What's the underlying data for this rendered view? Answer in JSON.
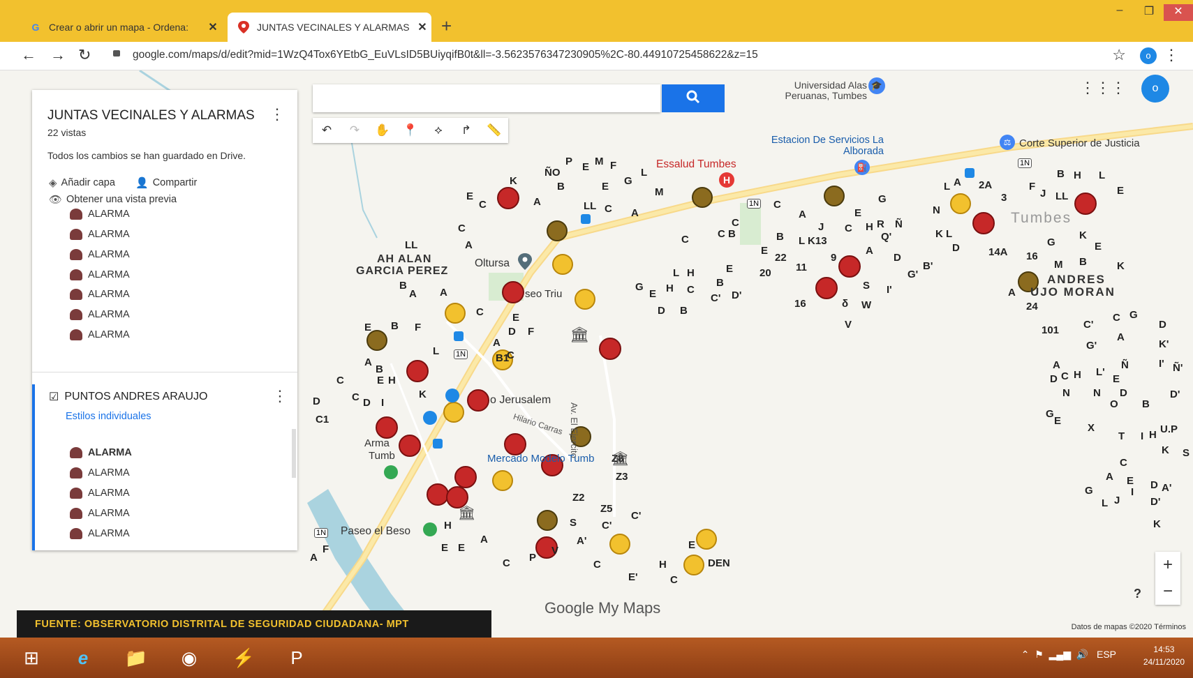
{
  "browser": {
    "tabs": [
      {
        "title": "Crear o abrir un mapa - Ordena:",
        "favicon": "google-g-icon"
      },
      {
        "title": "JUNTAS VECINALES Y ALARMAS",
        "favicon": "my-maps-icon",
        "active": true
      }
    ],
    "new_tab": "+",
    "url": "google.com/maps/d/edit?mid=1WzQ4Tox6YEtbG_EuVLsID5BUiyqifB0t&ll=-3.5623576347230905%2C-80.44910725458622&z=15",
    "profile_initial": "o"
  },
  "panel": {
    "title": "JUNTAS VECINALES Y ALARMAS",
    "views": "22 vistas",
    "saved": "Todos los cambios se han guardado en Drive.",
    "add_layer": "Añadir capa",
    "share": "Compartir",
    "preview": "Obtener una vista previa",
    "layer1_items": [
      "ALARMA",
      "ALARMA",
      "ALARMA",
      "ALARMA",
      "ALARMA",
      "ALARMA",
      "ALARMA"
    ],
    "layer2": {
      "title": "PUNTOS ANDRES ARAUJO",
      "style": "Estilos individuales",
      "items": [
        "ALARMA",
        "ALARMA",
        "ALARMA",
        "ALARMA",
        "ALARMA"
      ]
    }
  },
  "map": {
    "places": {
      "university": "Universidad Alas Peruanas, Tumbes",
      "gas": "Estacion De Servicios La Alborada",
      "court": "Corte Superior de Justicia",
      "hospital": "Essalud Tumbes",
      "oltursa": "Oltursa",
      "jerusalem": "o Jerusalem",
      "mercado": "Mercado Modelo Tumb",
      "paseo_beso": "Paseo el Beso",
      "paseo_tri": "seo Triu",
      "tumbes": "Tumbes",
      "ah_alan": "AH ALAN",
      "garcia": "GARCIA PEREZ",
      "andres": "ANDRES",
      "araujo": "UJO MORAN",
      "ejercito": "Av. El Ejercito",
      "hilario": "Hilario Carras",
      "arma": "Arma",
      "tumb_left": "Tumb"
    },
    "logo": "Google My Maps",
    "attribution": "Datos de mapas ©2020   Términos",
    "source": "FUENTE: OBSERVATORIO DISTRITAL DE SEGURIDAD CIUDADANA- MPT"
  },
  "taskbar": {
    "time": "14:53",
    "date": "24/11/2020",
    "lang": "ESP"
  }
}
